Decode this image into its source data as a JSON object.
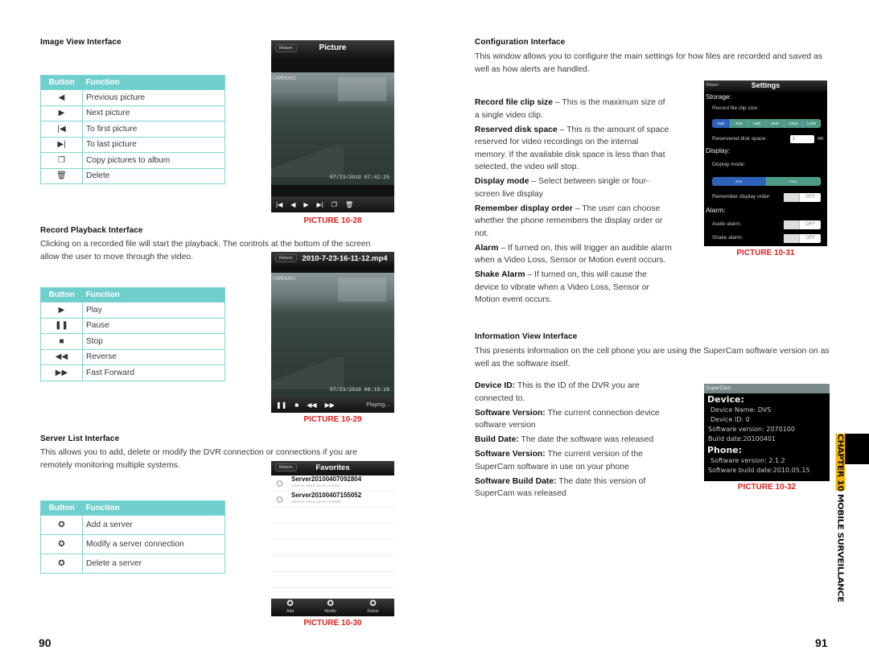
{
  "left_page": {
    "image_view": {
      "title": "Image View Interface",
      "table_header": {
        "button": "Button",
        "function": "Function"
      },
      "rows": [
        {
          "icon": "◀",
          "icon_name": "previous-icon",
          "function": "Previous picture"
        },
        {
          "icon": "▶",
          "icon_name": "next-icon",
          "function": "Next picture"
        },
        {
          "icon": "|◀",
          "icon_name": "first-icon",
          "function": "To first picture"
        },
        {
          "icon": "▶|",
          "icon_name": "last-icon",
          "function": "To last picture"
        },
        {
          "icon": "❐",
          "icon_name": "copy-icon",
          "function": "Copy pictures to album"
        },
        {
          "icon": "🗑",
          "icon_name": "trash-icon",
          "function": "Delete"
        }
      ],
      "phone": {
        "return_label": "Return",
        "title": "Picture",
        "camera_label": "CAMERA01",
        "timestamp": "07/23/2010 07:42:25",
        "controls": [
          "|◀",
          "◀",
          "▶",
          "▶|",
          "❐",
          "🗑"
        ]
      },
      "caption": "PICTURE 10-28"
    },
    "record_playback": {
      "title": "Record Playback Interface",
      "description": "Clicking on a recorded file will start the playback. The controls at the bottom of the screen allow the user to move through the video.",
      "table_header": {
        "button": "Button",
        "function": "Function"
      },
      "rows": [
        {
          "icon": "▶",
          "icon_name": "play-icon",
          "function": "Play"
        },
        {
          "icon": "❚❚",
          "icon_name": "pause-icon",
          "function": "Pause"
        },
        {
          "icon": "■",
          "icon_name": "stop-icon",
          "function": "Stop"
        },
        {
          "icon": "◀◀",
          "icon_name": "reverse-icon",
          "function": "Reverse"
        },
        {
          "icon": "▶▶",
          "icon_name": "fast-forward-icon",
          "function": "Fast Forward"
        }
      ],
      "phone": {
        "return_label": "Return",
        "title": "2010-7-23-16-11-12.mp4",
        "camera_label": "CAMERA01",
        "timestamp": "07/23/2010 08:10:19",
        "controls": [
          "❚❚",
          "■",
          "◀◀",
          "▶▶"
        ],
        "status": "Playing..."
      },
      "caption": "PICTURE 10-29"
    },
    "server_list": {
      "title": "Server List Interface",
      "description": "This allows you to add, delete or modify the DVR connection or connections if you are remotely monitoring multiple systems.",
      "table_header": {
        "button": "Button",
        "function": "Function"
      },
      "rows": [
        {
          "icon": "✪",
          "icon_name": "add-server-icon",
          "function": "Add a server"
        },
        {
          "icon": "✪",
          "icon_name": "modify-server-icon",
          "function": "Modify a server connection"
        },
        {
          "icon": "✪",
          "icon_name": "delete-server-icon",
          "function": "Delete a server"
        }
      ],
      "phone": {
        "return_label": "Return",
        "title": "Favorites",
        "servers": [
          {
            "name": "Server20100407092804",
            "address": "Address: demo.tvt.net.cn:5204"
          },
          {
            "name": "Server20100407155052",
            "address": "Address: demo.tvt.net.cn:5008"
          }
        ],
        "bottom_buttons": [
          "Add",
          "Modify",
          "Delete"
        ]
      },
      "caption": "PICTURE 10-30"
    },
    "page_number": "90"
  },
  "right_page": {
    "configuration": {
      "title": "Configuration Interface",
      "description": "This window allows you to configure the main settings for how files are recorded and saved as well as how alerts are handled.",
      "items": [
        {
          "term": "Record file clip size",
          "text": " – This is the maximum size of a single video clip."
        },
        {
          "term": "Reserved disk space",
          "text": " – This is the amount of space reserved for video recordings on the internal memory. If the available disk space is less than that selected, the video will stop."
        },
        {
          "term": "Display mode",
          "text": " – Select between single or four-screen live display"
        },
        {
          "term": "Remember display order",
          "text": " – The user can choose whether the phone remembers the display order or not."
        },
        {
          "term": "Alarm",
          "text": " – If turned on, this will trigger an audible alarm when a Video Loss, Sensor or Motion event occurs."
        },
        {
          "term": "Shake Alarm",
          "text": " – If turned on, this will cause the device to vibrate when a Video Loss, Sensor or Motion event occurs."
        }
      ],
      "phone": {
        "return_label": "Return",
        "title": "Settings",
        "storage_label": "Storage:",
        "clip_size_label": "Record file clip size:",
        "clip_sizes": [
          "2MB",
          "4MB",
          "6MB",
          "8MB",
          "10MB",
          "12MB"
        ],
        "clip_selected": "2MB",
        "reserved_label": "Reservered disk space:",
        "reserved_value": "1",
        "reserved_unit": "MB",
        "display_label": "Display:",
        "display_mode_label": "Display mode:",
        "display_modes": [
          "One",
          "Four"
        ],
        "display_selected": "One",
        "remember_label": "Remember display order:",
        "remember_value": "OFF",
        "alarm_label": "Alarm:",
        "audio_alarm_label": "Audio alarm:",
        "audio_alarm_value": "OFF",
        "shake_alarm_label": "Shake alarm:",
        "shake_alarm_value": "OFF"
      },
      "caption": "PICTURE 10-31"
    },
    "information": {
      "title": "Information View Interface",
      "description": "This presents information on the cell phone you are using the SuperCam software version on as well as the software itself.",
      "items": [
        {
          "term": "Device ID:",
          "text": " This is the ID of the DVR you are connected to."
        },
        {
          "term": "Software Version:",
          "text": " The current connection device software version"
        },
        {
          "term": "Build Date:",
          "text": " The date the software was released"
        },
        {
          "term": "Software Version:",
          "text": " The current version of the SuperCam software in use on your phone"
        },
        {
          "term": "Software Build Date:",
          "text": " The date this version of SuperCam was released"
        }
      ],
      "phone": {
        "app_title": "SuperCam",
        "device_heading": "Device:",
        "device_name": "Device Name:  DVS",
        "device_id": "Device ID:    0",
        "software_version": "Software version: 2070100",
        "build_date": "Build date:20100401",
        "phone_heading": "Phone:",
        "phone_software_version": "Software version:  2.1.2",
        "phone_build_date": "Software build date:2010.05.15"
      },
      "caption": "PICTURE 10-32"
    },
    "chapter_tab": {
      "chapter": "CHAPTER 10",
      "title": "MOBILE SURVEILLANCE"
    },
    "page_number": "91"
  }
}
